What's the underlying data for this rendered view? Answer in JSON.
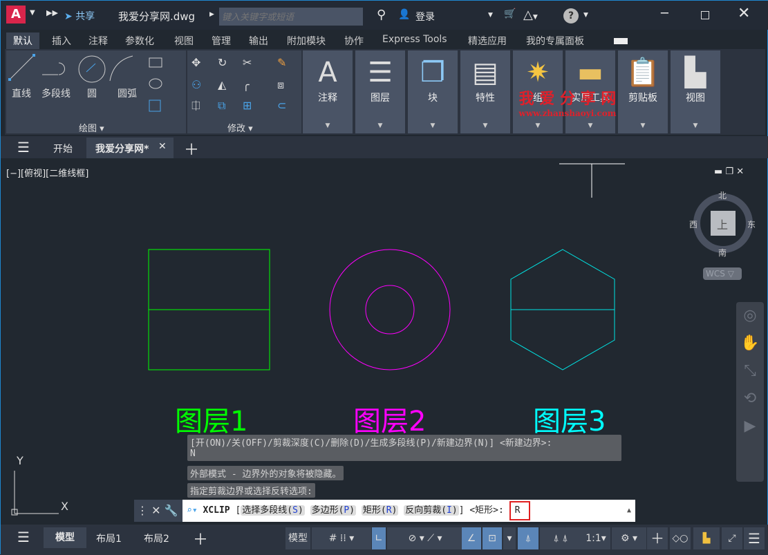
{
  "title_bar": {
    "app_logo": "A",
    "share": "共享",
    "filename": "我爱分享网.dwg",
    "search_placeholder": "键入关键字或短语",
    "login": "登录",
    "help": "?"
  },
  "ribbon_tabs": [
    "默认",
    "插入",
    "注释",
    "参数化",
    "视图",
    "管理",
    "输出",
    "附加模块",
    "协作",
    "Express Tools",
    "精选应用",
    "我的专属面板"
  ],
  "draw_panel": {
    "tools": [
      "直线",
      "多段线",
      "圆",
      "圆弧"
    ],
    "title": "绘图"
  },
  "modify_panel": {
    "title": "修改"
  },
  "big_panels": [
    "注释",
    "图层",
    "块",
    "特性",
    "组",
    "实用工具",
    "剪贴板",
    "视图"
  ],
  "watermark": {
    "title": "我 爱 分 享 网",
    "url": "www.zhanshaoyi.com"
  },
  "file_tabs": {
    "start": "开始",
    "current": "我爱分享网*"
  },
  "viewport": {
    "label": "[−][俯视][二维线框]",
    "compass": {
      "n": "北",
      "s": "南",
      "e": "东",
      "w": "西",
      "top": "上"
    },
    "wcs": "WCS"
  },
  "drawing": {
    "labels": [
      "图层1",
      "图层2",
      "图层3"
    ],
    "colors": [
      "#00ff00",
      "#ff00ff",
      "#00ffff"
    ]
  },
  "ucs": {
    "x": "X",
    "y": "Y"
  },
  "command": {
    "history": [
      "[开(ON)/关(OFF)/剪裁深度(C)/删除(D)/生成多段线(P)/新建边界(N)] <新建边界>:",
      "N",
      "外部模式 - 边界外的对象将被隐藏。",
      "指定剪裁边界或选择反转选项:"
    ],
    "name": "XCLIP",
    "opts": [
      {
        "t": "选择多段线(",
        "k": "S"
      },
      {
        "t": "多边形(",
        "k": "P"
      },
      {
        "t": "矩形(",
        "k": "R"
      },
      {
        "t": "反向剪裁(",
        "k": "I"
      }
    ],
    "default": "] <矩形>:",
    "value": "R"
  },
  "status": {
    "layouts": [
      "模型",
      "布局1",
      "布局2"
    ],
    "model_btn": "模型",
    "scale": "1:1"
  }
}
